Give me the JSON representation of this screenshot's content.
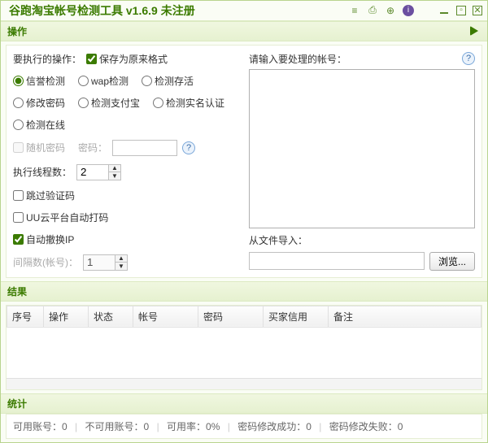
{
  "title": "谷跑淘宝帐号检测工具 v1.6.9 未注册",
  "sections": {
    "operation": "操作",
    "results": "结果",
    "stats": "统计"
  },
  "op_label": "要执行的操作：",
  "preserve_format": "保存为原来格式",
  "radios": {
    "r1": "信誉检测",
    "r2": "wap检测",
    "r3": "检测存活",
    "r4": "修改密码",
    "r5": "检测支付宝",
    "r6": "检测实名认证",
    "r7": "检测在线"
  },
  "random_pwd": "随机密码",
  "pwd_label": "密码：",
  "pwd_value": "",
  "thread_label": "执行线程数：",
  "thread_value": "2",
  "chk_skip": "跳过验证码",
  "chk_uu": "UU云平台自动打码",
  "chk_autoip": "自动撤换IP",
  "interval_label": "间隔数(帐号)：",
  "interval_value": "1",
  "input_accounts_label": "请输入要处理的帐号：",
  "accounts_value": "",
  "import_label": "从文件导入：",
  "import_value": "",
  "browse": "浏览...",
  "columns": {
    "c1": "序号",
    "c2": "操作",
    "c3": "状态",
    "c4": "帐号",
    "c5": "密码",
    "c6": "买家信用",
    "c7": "备注"
  },
  "stats": {
    "usable_label": "可用账号：",
    "usable_val": "0",
    "unusable_label": "不可用账号：",
    "unusable_val": "0",
    "rate_label": "可用率：",
    "rate_val": "0%",
    "pwd_ok_label": "密码修改成功：",
    "pwd_ok_val": "0",
    "pwd_fail_label": "密码修改失败：",
    "pwd_fail_val": "0"
  }
}
